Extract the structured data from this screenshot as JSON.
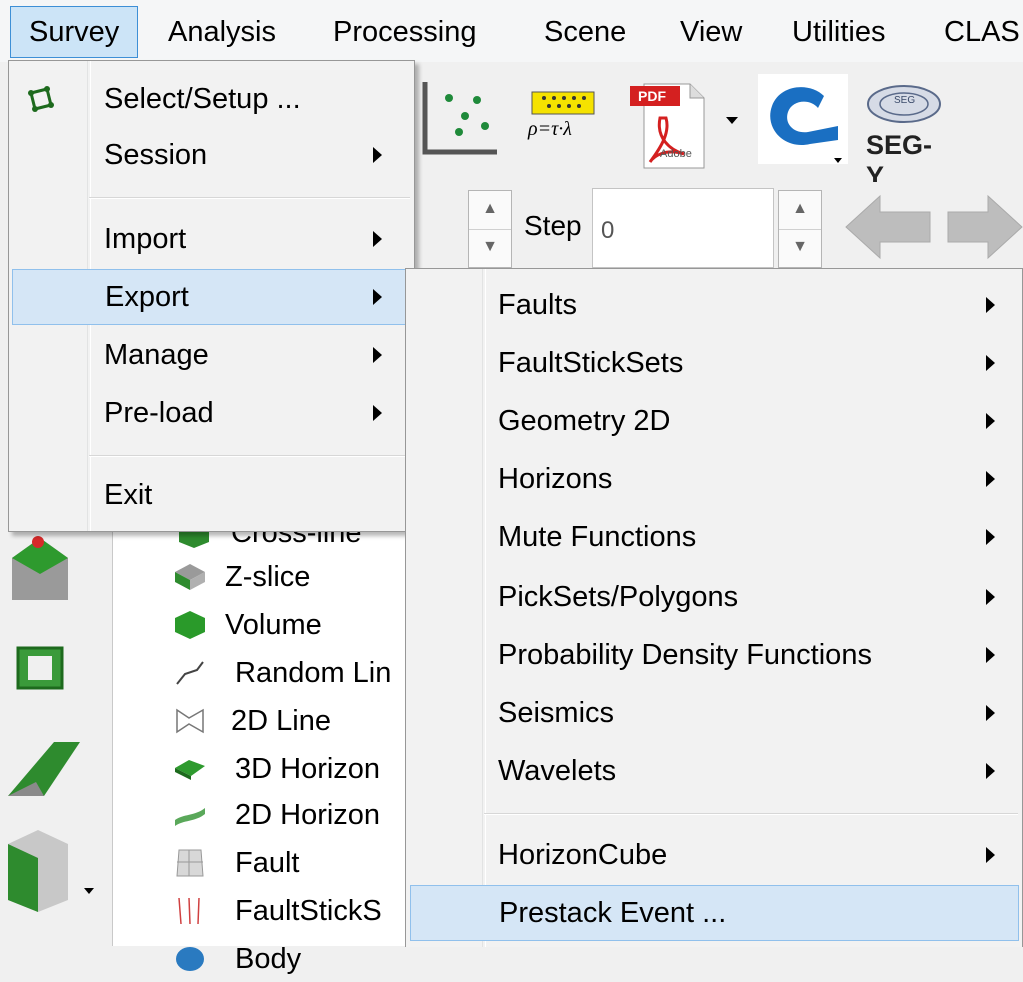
{
  "menubar": {
    "items": [
      {
        "label": "Survey",
        "active": true
      },
      {
        "label": "Analysis"
      },
      {
        "label": "Processing"
      },
      {
        "label": "Scene"
      },
      {
        "label": "View"
      },
      {
        "label": "Utilities"
      },
      {
        "label": "CLAS"
      }
    ]
  },
  "toolbar": {
    "rho_formula": "ρ=τ·λ",
    "pdf_badge": "PDF",
    "pdf_footer": "Adobe",
    "segy_label": "SEG-Y",
    "segy_seal_text": "SEG"
  },
  "slicerow": {
    "step_label": "Step",
    "step_value": "0"
  },
  "tree": {
    "items": [
      {
        "label": "Cross-line",
        "icon": "crossline-icon"
      },
      {
        "label": "Z-slice",
        "icon": "zslice-icon"
      },
      {
        "label": "Volume",
        "icon": "volume-icon"
      },
      {
        "label": "Random Lin",
        "icon": "random-line-icon"
      },
      {
        "label": "2D Line",
        "icon": "2d-line-icon"
      },
      {
        "label": "3D Horizon",
        "icon": "3d-horizon-icon"
      },
      {
        "label": "2D Horizon",
        "icon": "2d-horizon-icon"
      },
      {
        "label": "Fault",
        "icon": "fault-icon"
      },
      {
        "label": "FaultStickS",
        "icon": "faultsticks-icon"
      },
      {
        "label": "Body",
        "icon": "body-icon"
      }
    ]
  },
  "survey_menu": {
    "items": [
      {
        "label": "Select/Setup ...",
        "icon": "survey-select-icon",
        "submenu": false
      },
      {
        "label": "Session",
        "submenu": true
      },
      {
        "label": "Import",
        "submenu": true
      },
      {
        "label": "Export",
        "submenu": true,
        "highlighted": true
      },
      {
        "label": "Manage",
        "submenu": true
      },
      {
        "label": "Pre-load",
        "submenu": true
      },
      {
        "label": "Exit",
        "submenu": false
      }
    ]
  },
  "export_menu": {
    "items": [
      {
        "label": "Faults",
        "submenu": true
      },
      {
        "label": "FaultStickSets",
        "submenu": true
      },
      {
        "label": "Geometry 2D",
        "submenu": true
      },
      {
        "label": "Horizons",
        "submenu": true
      },
      {
        "label": "Mute Functions",
        "submenu": true
      },
      {
        "label": "PickSets/Polygons",
        "submenu": true
      },
      {
        "label": "Probability Density Functions",
        "submenu": true
      },
      {
        "label": "Seismics",
        "submenu": true
      },
      {
        "label": "Wavelets",
        "submenu": true
      },
      {
        "label": "HorizonCube",
        "submenu": true
      },
      {
        "label": "Prestack Event ...",
        "submenu": false,
        "highlighted": true
      }
    ]
  },
  "colors": {
    "highlight_bg": "#d5e6f6",
    "highlight_border": "#90c0ec",
    "active_menubar_bg": "#cce4f7",
    "green_icon": "#2e8b2e"
  }
}
